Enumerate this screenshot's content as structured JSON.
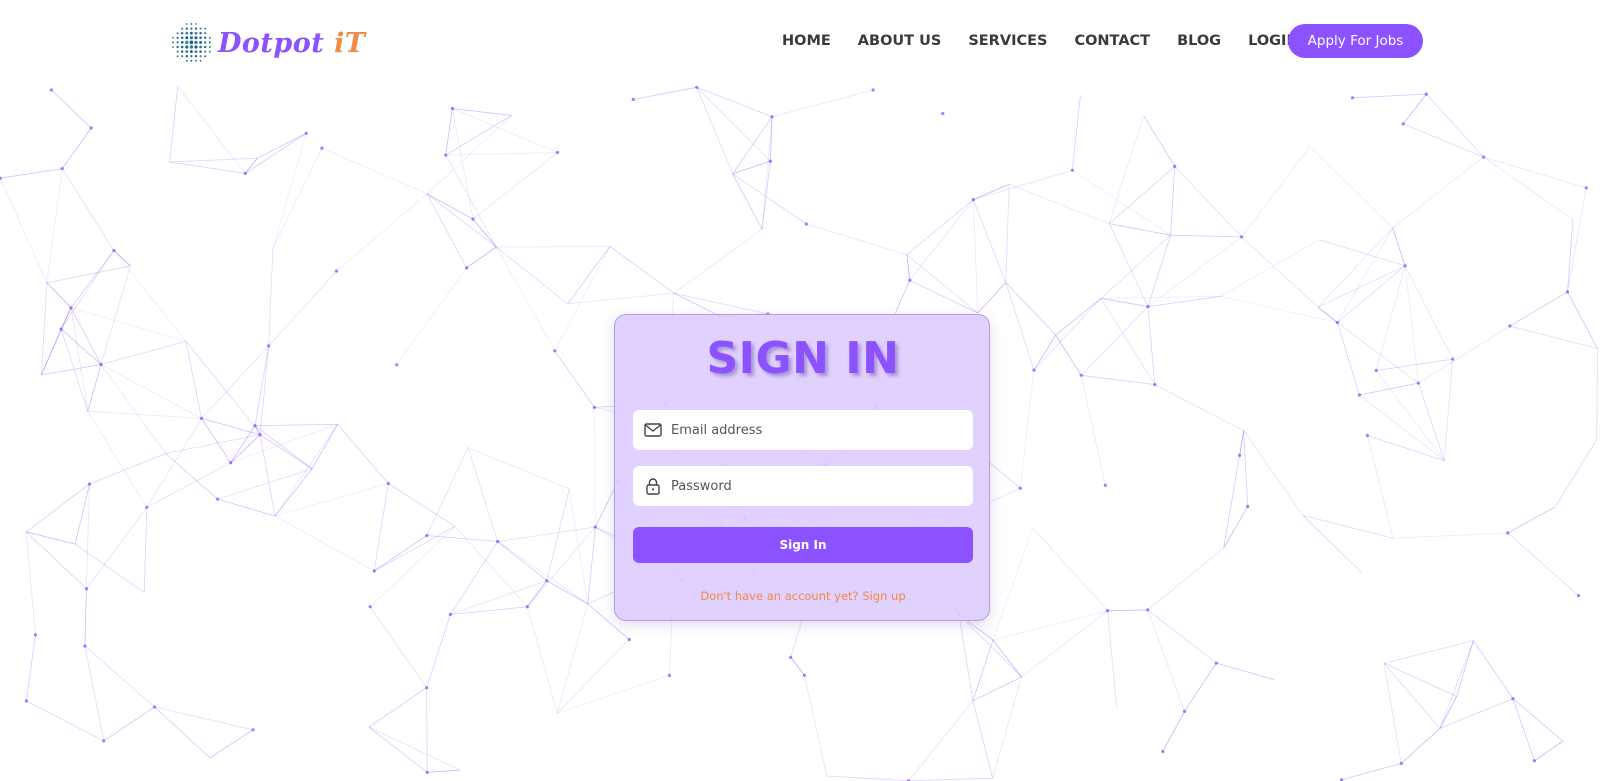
{
  "brand": {
    "name_part1": "Dotpot ",
    "name_part2": "iT",
    "color_primary": "#8c52ff",
    "color_secondary": "#f08a44"
  },
  "nav": {
    "items": [
      "HOME",
      "ABOUT US",
      "SERVICES",
      "CONTACT",
      "BLOG",
      "LOGIN"
    ],
    "cta_label": "Apply For Jobs"
  },
  "signin": {
    "title": "SIGN IN",
    "email_placeholder": "Email address",
    "email_icon": "envelope-icon",
    "password_placeholder": "Password",
    "password_icon": "lock-icon",
    "submit_label": "Sign In",
    "signup_text": "Don't have an account yet? Sign up"
  },
  "colors": {
    "accent": "#8c52ff",
    "link": "#f08a44",
    "card_background": "#decdff"
  }
}
